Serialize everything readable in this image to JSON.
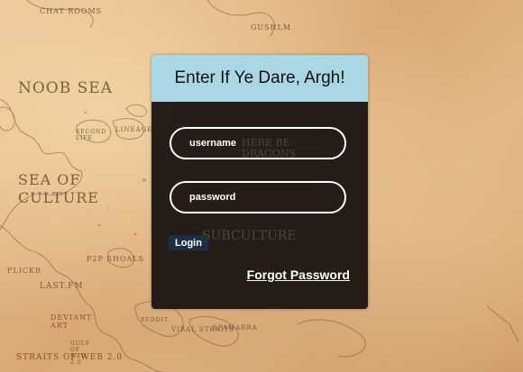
{
  "background": {
    "labels": {
      "noob_sea": "NOOB SEA",
      "sea_of_culture": "SEA OF CULTURE",
      "chat_rooms": "CHAT ROOMS",
      "gushlm": "GUSHLM",
      "lineage": "LINEAGE",
      "second_life": "SECOND LIFE",
      "p2p_shoals": "P2P SHOALS",
      "flickr": "FLICKR",
      "last_fm": "LAST.FM",
      "deviant_art": "DEVIANT ART",
      "gulf": "GULF OF WEB 2.0",
      "straits": "STRAITS OF WEB 2.0",
      "reddit": "REDDIT",
      "viral_straits": "VIRAL STRAITS",
      "spamarra": "SPAMARRA",
      "here_be_dragons": "HERE BE DRAGONS",
      "subculture": "SUBCULTURE"
    }
  },
  "login": {
    "title": "Enter If Ye Dare, Argh!",
    "username_placeholder": "username",
    "password_placeholder": "password",
    "login_button": "Login",
    "forgot_link": "Forgot Password"
  },
  "colors": {
    "header_bg": "#a9d8e4",
    "panel_bg": "#16110e",
    "button_bg": "#1d2f44"
  }
}
